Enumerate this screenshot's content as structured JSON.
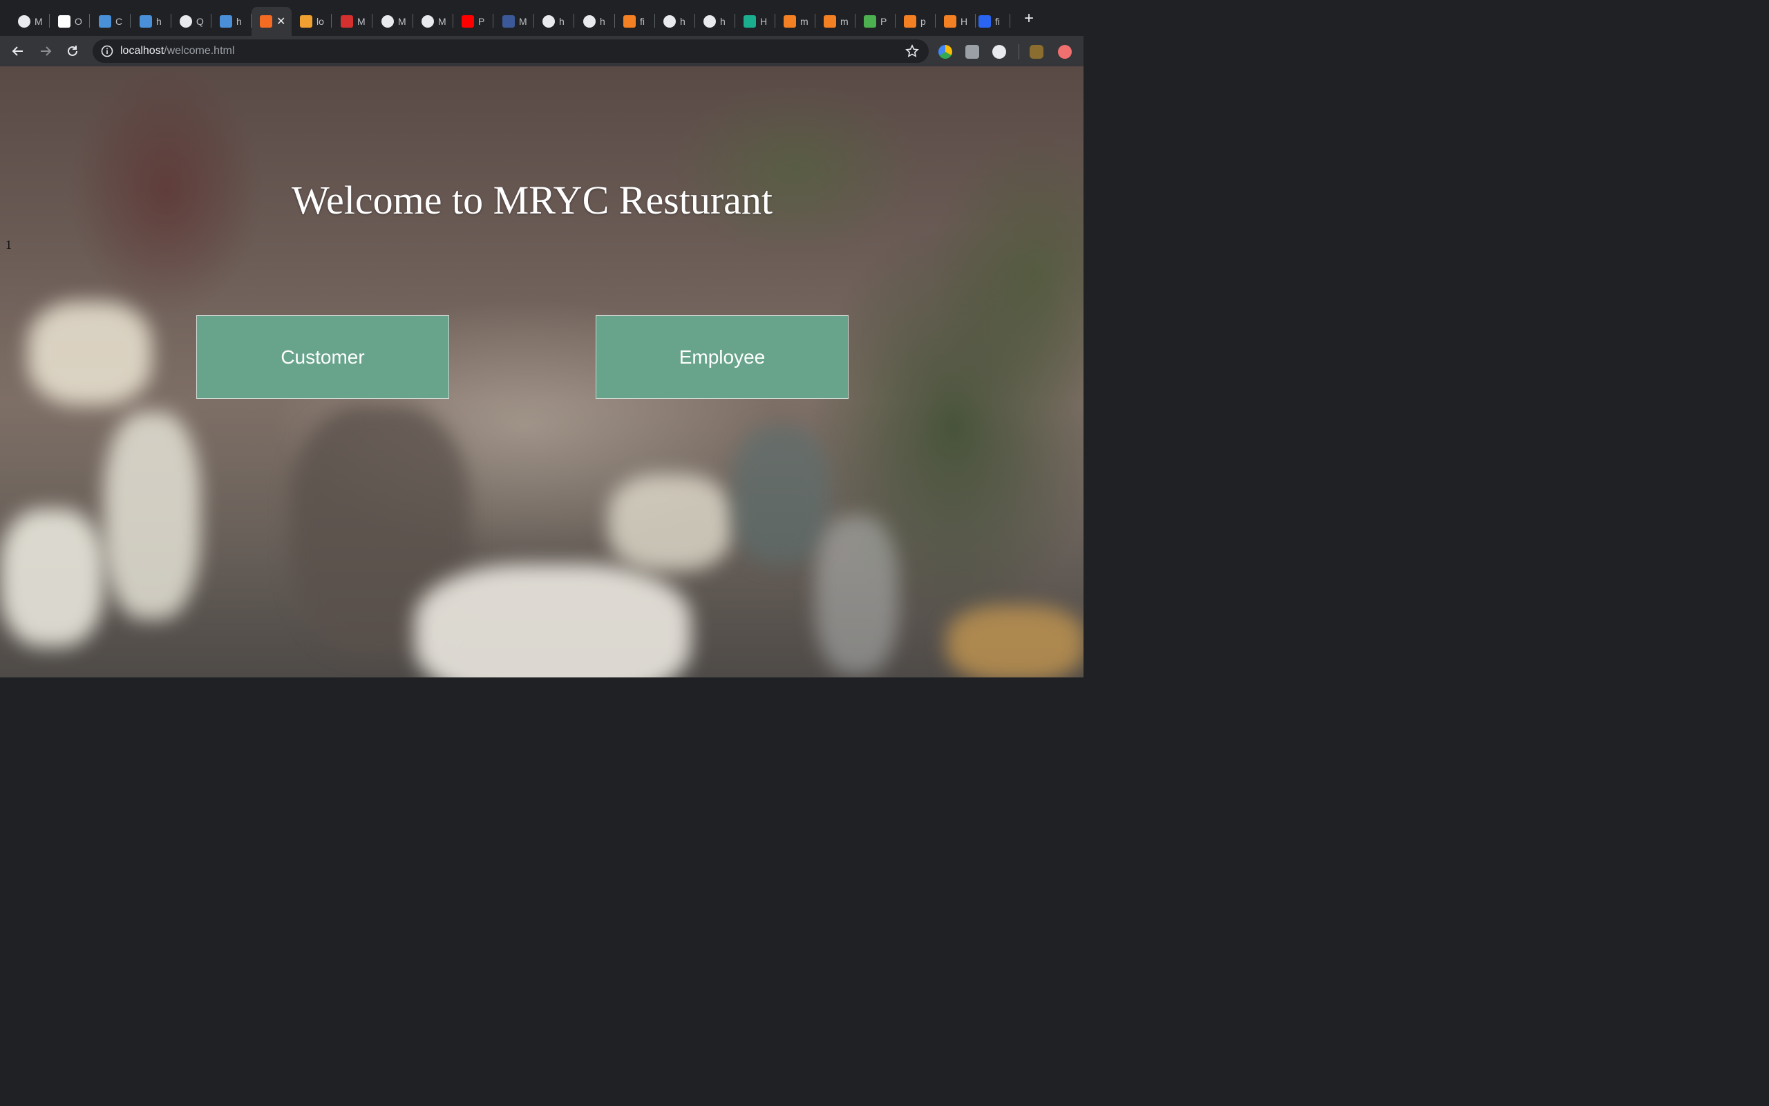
{
  "browser": {
    "tabs": [
      {
        "icon": "globe-icon",
        "title": "M",
        "color": "#e8eaed"
      },
      {
        "icon": "site-logo-icon",
        "title": "O",
        "color": "#ffffff"
      },
      {
        "icon": "p-logo-icon",
        "title": "C",
        "color": "#4a90d9"
      },
      {
        "icon": "p-logo-icon",
        "title": "h",
        "color": "#4a90d9"
      },
      {
        "icon": "globe-icon",
        "title": "Q",
        "color": "#e8eaed"
      },
      {
        "icon": "p-logo-icon",
        "title": "h",
        "color": "#4a90d9"
      },
      {
        "icon": "xampp-icon",
        "title": "",
        "color": "#f46b22",
        "active": true
      },
      {
        "icon": "pma-icon",
        "title": "lo",
        "color": "#f0a030"
      },
      {
        "icon": "ubc-canvas-icon",
        "title": "M",
        "color": "#d3302f"
      },
      {
        "icon": "globe-icon",
        "title": "M",
        "color": "#e8eaed"
      },
      {
        "icon": "globe-icon",
        "title": "M",
        "color": "#e8eaed"
      },
      {
        "icon": "youtube-icon",
        "title": "P",
        "color": "#ff0000"
      },
      {
        "icon": "facebook-icon",
        "title": "M",
        "color": "#3b5998"
      },
      {
        "icon": "globe-icon",
        "title": "h",
        "color": "#e8eaed"
      },
      {
        "icon": "globe-icon",
        "title": "h",
        "color": "#e8eaed"
      },
      {
        "icon": "stackoverflow-icon",
        "title": "fi",
        "color": "#f48024"
      },
      {
        "icon": "globe-icon",
        "title": "h",
        "color": "#e8eaed"
      },
      {
        "icon": "globe-icon",
        "title": "h",
        "color": "#e8eaed"
      },
      {
        "icon": "hexagon-icon",
        "title": "H",
        "color": "#1aae8f"
      },
      {
        "icon": "stackoverflow-icon",
        "title": "m",
        "color": "#f48024"
      },
      {
        "icon": "stackoverflow-icon",
        "title": "m",
        "color": "#f48024"
      },
      {
        "icon": "w3-icon",
        "title": "P",
        "color": "#4caf50"
      },
      {
        "icon": "stackoverflow-icon",
        "title": "p",
        "color": "#f48024"
      },
      {
        "icon": "stackoverflow-icon",
        "title": "H",
        "color": "#f48024"
      },
      {
        "icon": "css-icon",
        "title": "fi",
        "color": "#2965f1"
      }
    ],
    "address": {
      "host": "localhost",
      "path": "/welcome.html"
    }
  },
  "page": {
    "title": "Welcome to MRYC Resturant",
    "stray_text": "1",
    "customer_label": "Customer",
    "employee_label": "Employee",
    "button_color": "#68a48b"
  }
}
